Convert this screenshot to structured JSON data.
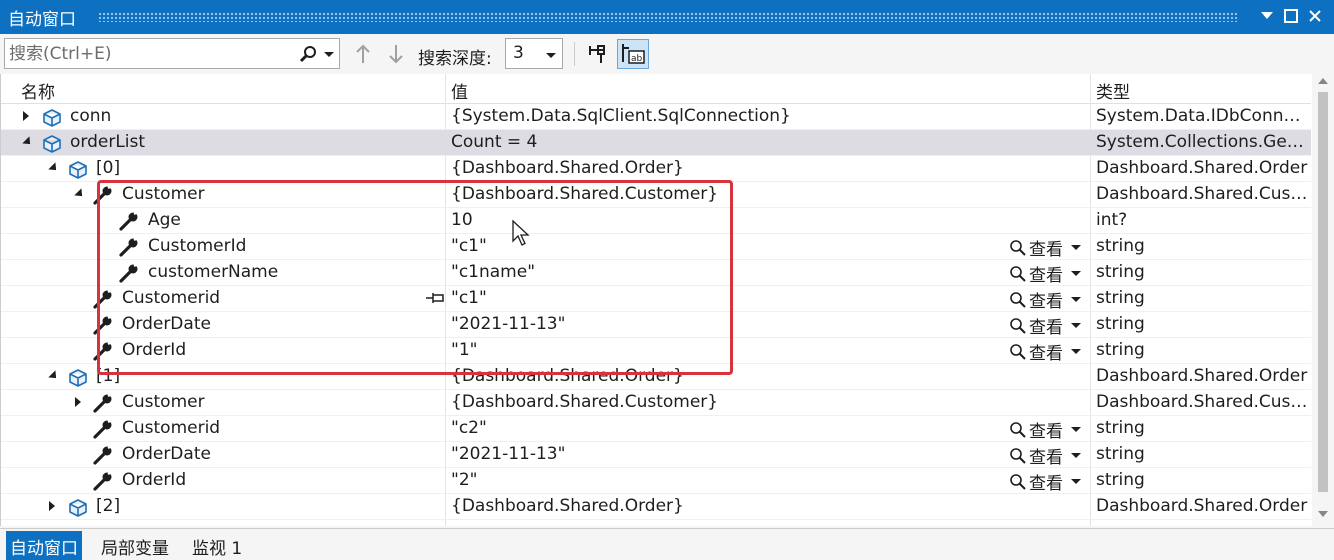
{
  "window": {
    "title": "自动窗口"
  },
  "toolbar": {
    "search_placeholder": "搜索(Ctrl+E)",
    "depth_label": "搜索深度:",
    "depth_value": "3"
  },
  "columns": {
    "name": "名称",
    "value": "值",
    "type": "类型"
  },
  "view_label": "查看",
  "rows": [
    {
      "name": "conn",
      "value": "{System.Data.SqlClient.SqlConnection}",
      "type": "System.Data.IDbConnection {System.Data.SqlClient.SqlConnection}"
    },
    {
      "name": "orderList",
      "value": "Count = 4",
      "type": "System.Collections.Generic.List<Dashboard.Shared.Order>"
    },
    {
      "name": "[0]",
      "value": "{Dashboard.Shared.Order}",
      "type": "Dashboard.Shared.Order"
    },
    {
      "name": "Customer",
      "value": "{Dashboard.Shared.Customer}",
      "type": "Dashboard.Shared.Customer"
    },
    {
      "name": "Age",
      "value": "10",
      "type": "int?"
    },
    {
      "name": "CustomerId",
      "value": "\"c1\"",
      "type": "string"
    },
    {
      "name": "customerName",
      "value": "\"c1name\"",
      "type": "string"
    },
    {
      "name": "Customerid",
      "value": "\"c1\"",
      "type": "string"
    },
    {
      "name": "OrderDate",
      "value": "\"2021-11-13\"",
      "type": "string"
    },
    {
      "name": "OrderId",
      "value": "\"1\"",
      "type": "string"
    },
    {
      "name": "[1]",
      "value": "{Dashboard.Shared.Order}",
      "type": "Dashboard.Shared.Order"
    },
    {
      "name": "Customer",
      "value": "{Dashboard.Shared.Customer}",
      "type": "Dashboard.Shared.Customer"
    },
    {
      "name": "Customerid",
      "value": "\"c2\"",
      "type": "string"
    },
    {
      "name": "OrderDate",
      "value": "\"2021-11-13\"",
      "type": "string"
    },
    {
      "name": "OrderId",
      "value": "\"2\"",
      "type": "string"
    },
    {
      "name": "[2]",
      "value": "{Dashboard.Shared.Order}",
      "type": "Dashboard.Shared.Order"
    }
  ],
  "tabs": [
    "自动窗口",
    "局部变量",
    "监视 1"
  ],
  "colors": {
    "accent": "#0e70c0",
    "highlight": "#d8323c"
  }
}
